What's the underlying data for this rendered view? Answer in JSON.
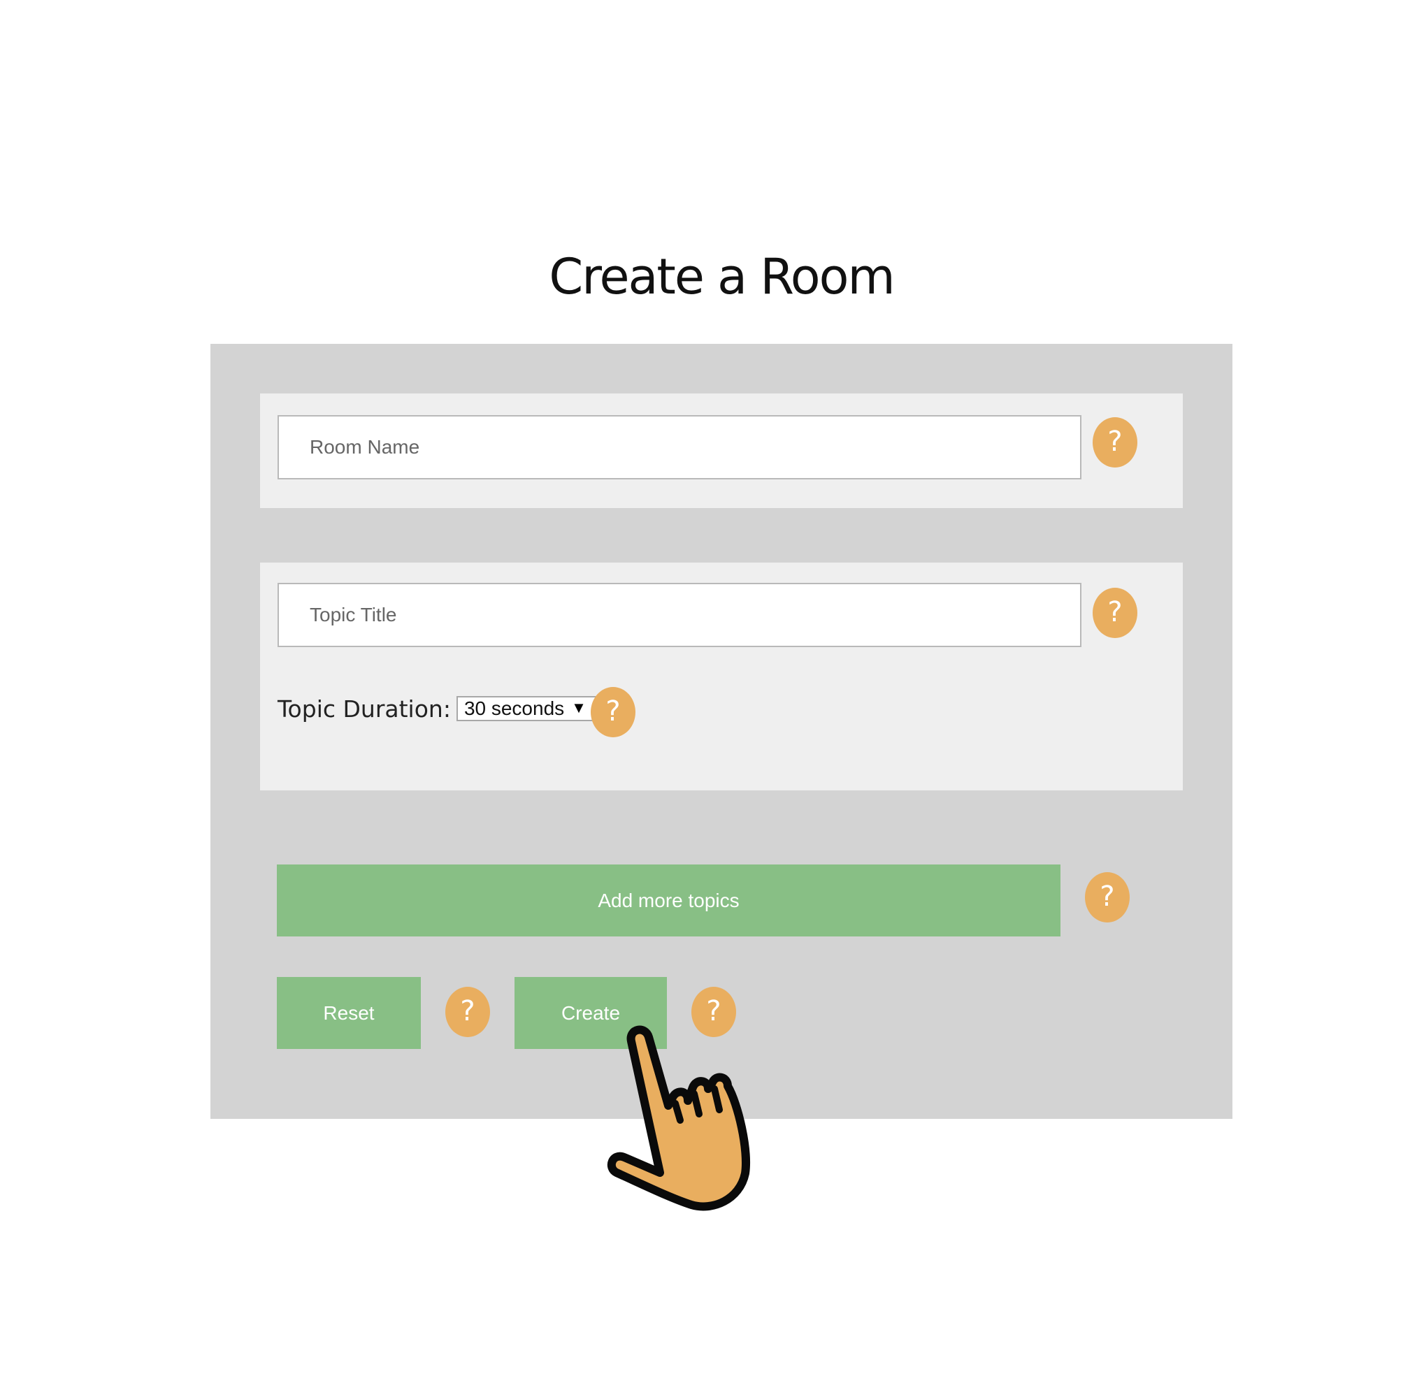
{
  "page": {
    "title": "Create a Room"
  },
  "form": {
    "room_name": {
      "placeholder": "Room Name",
      "value": "",
      "help_label": "?"
    },
    "topic_title": {
      "placeholder": "Topic Title",
      "value": "",
      "help_label": "?"
    },
    "topic_duration": {
      "label": "Topic Duration:",
      "selected": "30 seconds",
      "arrow": "▼",
      "help_label": "?"
    },
    "buttons": {
      "add_more_topics": "Add more topics",
      "add_help_label": "?",
      "reset": "Reset",
      "reset_help_label": "?",
      "create": "Create",
      "create_help_label": "?"
    }
  },
  "colors": {
    "panel_background": "#d3d3d3",
    "card_background": "#efefef",
    "button_green": "#88bf85",
    "help_orange": "#e9ae5f",
    "cursor_fill": "#e9ae5f"
  },
  "icons": {
    "help": "question-mark-icon",
    "cursor": "hand-pointer-icon",
    "dropdown": "chevron-down-icon"
  }
}
